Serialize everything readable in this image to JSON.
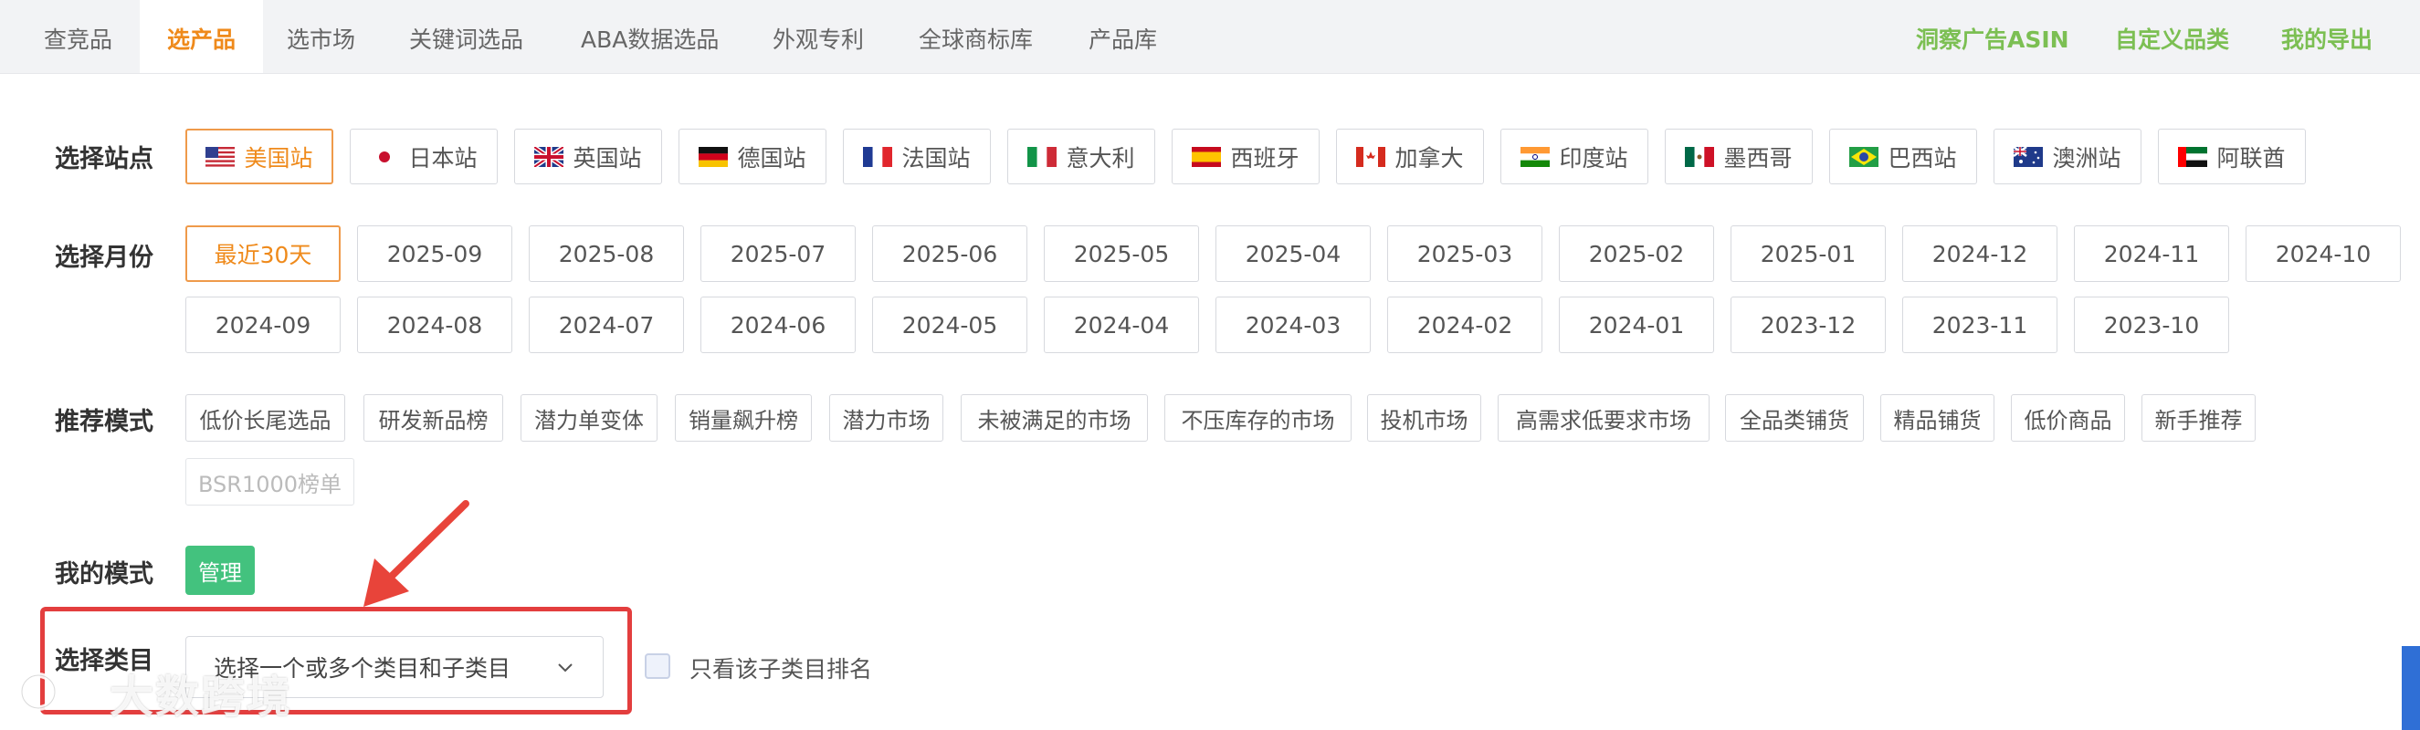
{
  "nav": {
    "tabs": [
      "查竞品",
      "选产品",
      "选市场",
      "关键词选品",
      "ABA数据选品",
      "外观专利",
      "全球商标库",
      "产品库"
    ],
    "active": 1,
    "right_links": [
      "洞察广告ASIN",
      "自定义品类",
      "我的导出"
    ],
    "active_color": "#ef8a1b",
    "link_color": "#7cbf53"
  },
  "sites": {
    "label": "选择站点",
    "items": [
      "美国站",
      "日本站",
      "英国站",
      "德国站",
      "法国站",
      "意大利",
      "西班牙",
      "加拿大",
      "印度站",
      "墨西哥",
      "巴西站",
      "澳洲站",
      "阿联酋"
    ],
    "selected": 0
  },
  "months": {
    "label": "选择月份",
    "items": [
      "最近30天",
      "2025-09",
      "2025-08",
      "2025-07",
      "2025-06",
      "2025-05",
      "2025-04",
      "2025-03",
      "2025-02",
      "2025-01",
      "2024-12",
      "2024-11",
      "2024-10",
      "2024-09",
      "2024-08",
      "2024-07",
      "2024-06",
      "2024-05",
      "2024-04",
      "2024-03",
      "2024-02",
      "2024-01",
      "2023-12",
      "2023-11",
      "2023-10"
    ],
    "selected": 0
  },
  "modes": {
    "label": "推荐模式",
    "items": [
      "低价长尾选品",
      "研发新品榜",
      "潜力单变体",
      "销量飙升榜",
      "潜力市场",
      "未被满足的市场",
      "不压库存的市场",
      "投机市场",
      "高需求低要求市场",
      "全品类铺货",
      "精品铺货",
      "低价商品",
      "新手推荐",
      "BSR1000榜单"
    ]
  },
  "my_mode": {
    "label": "我的模式",
    "manage": "管理"
  },
  "category": {
    "label": "选择类目",
    "placeholder": "选择一个或多个类目和子类目",
    "checkbox_label": "只看该子类目排名"
  },
  "watermark": "大数跨境",
  "colors": {
    "selected_border": "#ef9a4a",
    "manage_bg": "#43c27e",
    "highlight_red": "#e33e3e"
  }
}
